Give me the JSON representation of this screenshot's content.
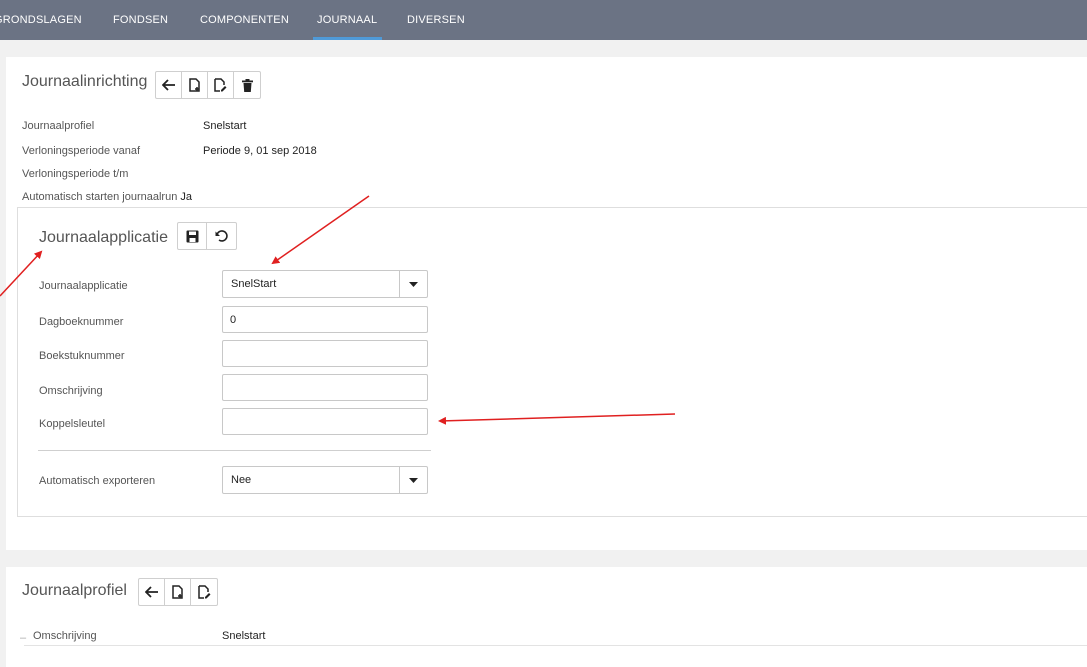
{
  "nav": {
    "items": [
      {
        "label": "GRONDSLAGEN",
        "active": false
      },
      {
        "label": "FONDSEN",
        "active": false
      },
      {
        "label": "COMPONENTEN",
        "active": false
      },
      {
        "label": "JOURNAAL",
        "active": true
      },
      {
        "label": "DIVERSEN",
        "active": false
      }
    ]
  },
  "journaalinrichting": {
    "title": "Journaalinrichting",
    "toolbar": [
      "back-arrow-icon",
      "new-document-icon",
      "edit-document-icon",
      "trash-icon"
    ],
    "fields": [
      {
        "label": "Journaalprofiel",
        "value": "Snelstart"
      },
      {
        "label": "Verloningsperiode vanaf",
        "value": "Periode 9, 01 sep 2018"
      },
      {
        "label": "Verloningsperiode t/m",
        "value": ""
      },
      {
        "label": "Automatisch starten journaalrun",
        "value": "Ja"
      }
    ]
  },
  "journaalapplicatie": {
    "title": "Journaalapplicatie",
    "toolbar": [
      "save-icon",
      "undo-icon"
    ],
    "applicatie": {
      "label": "Journaalapplicatie",
      "value": "SnelStart"
    },
    "dagboeknummer": {
      "label": "Dagboeknummer",
      "value": "0"
    },
    "boekstuknummer": {
      "label": "Boekstuknummer",
      "value": ""
    },
    "omschrijving": {
      "label": "Omschrijving",
      "value": ""
    },
    "koppelsleutel": {
      "label": "Koppelsleutel",
      "value": ""
    },
    "exporteren": {
      "label": "Automatisch exporteren",
      "value": "Nee"
    }
  },
  "journaalprofiel": {
    "title": "Journaalprofiel",
    "toolbar": [
      "back-arrow-icon",
      "new-document-icon",
      "edit-document-icon"
    ],
    "omschrijving": {
      "label": "Omschrijving",
      "value": "Snelstart"
    }
  },
  "colors": {
    "nav_bg": "#6b7384",
    "nav_active_underline": "#4f9ad8",
    "annotation_arrow": "#e02020"
  }
}
